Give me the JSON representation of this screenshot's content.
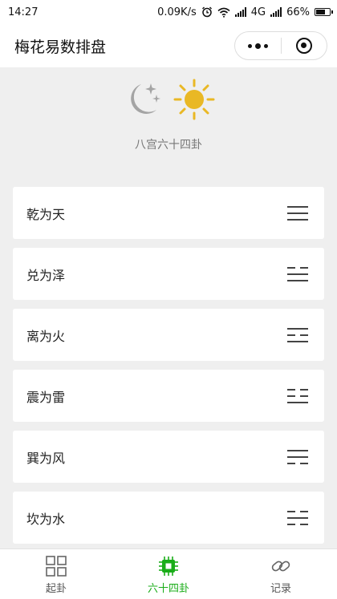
{
  "status": {
    "time": "14:27",
    "speed": "0.09K/s",
    "network": "4G",
    "battery": "66%",
    "battery_level": 0.66
  },
  "nav": {
    "title": "梅花易数排盘"
  },
  "header": {
    "subtitle": "八宫六十四卦",
    "icons": [
      "moon-stars-icon",
      "sun-icon"
    ]
  },
  "hexagrams": [
    {
      "name": "乾为天",
      "trigram": [
        1,
        1,
        1
      ]
    },
    {
      "name": "兑为泽",
      "trigram": [
        0,
        1,
        1
      ]
    },
    {
      "name": "离为火",
      "trigram": [
        1,
        0,
        1
      ]
    },
    {
      "name": "震为雷",
      "trigram": [
        0,
        0,
        1
      ]
    },
    {
      "name": "巽为风",
      "trigram": [
        1,
        1,
        0
      ]
    },
    {
      "name": "坎为水",
      "trigram": [
        0,
        1,
        0
      ]
    }
  ],
  "tabs": [
    {
      "label": "起卦",
      "icon": "grid-icon",
      "active": false
    },
    {
      "label": "六十四卦",
      "icon": "chip-icon",
      "active": true
    },
    {
      "label": "记录",
      "icon": "link-icon",
      "active": false
    }
  ],
  "colors": {
    "accent": "#1aad19",
    "sun": "#e9b825",
    "moon": "#a4a4a4",
    "background": "#efefef"
  }
}
